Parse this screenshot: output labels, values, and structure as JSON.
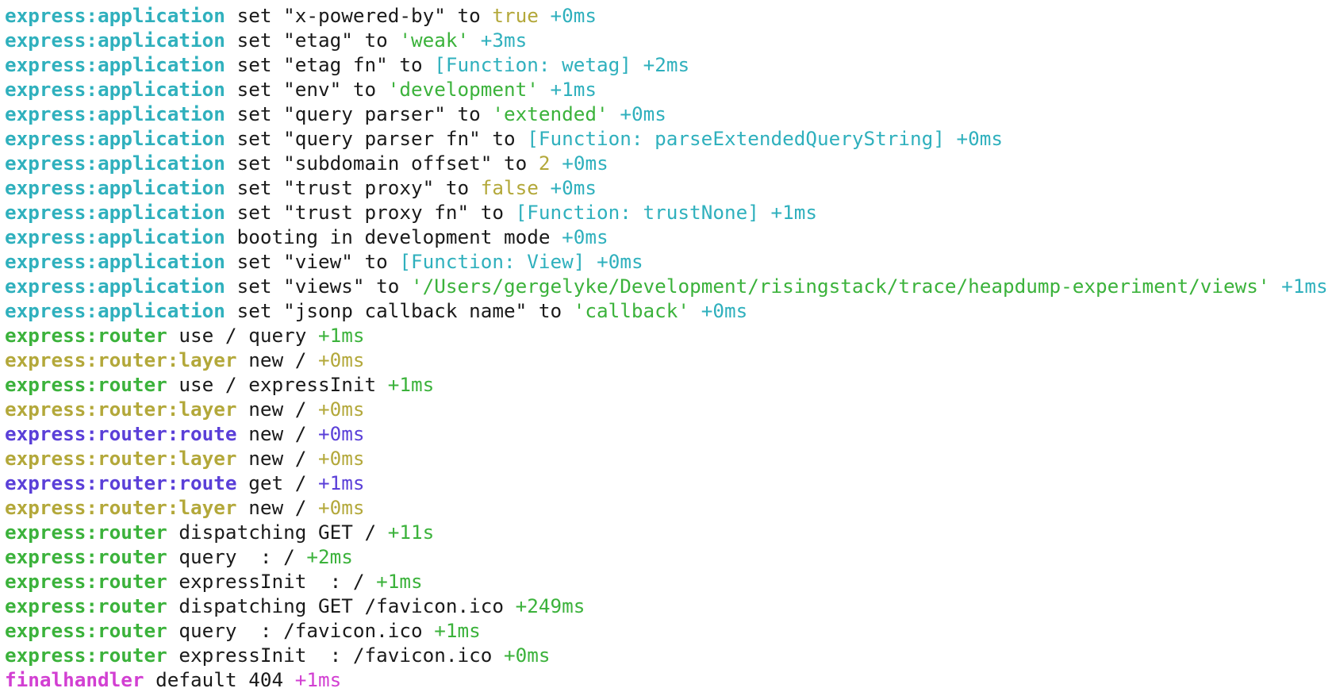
{
  "terminal": {
    "lines": [
      {
        "ns": "express:application",
        "ns_type": "application",
        "parts": [
          {
            "t": "msg",
            "v": " set \"x-powered-by\" to "
          },
          {
            "t": "bool",
            "v": "true"
          }
        ],
        "diff": "+0ms"
      },
      {
        "ns": "express:application",
        "ns_type": "application",
        "parts": [
          {
            "t": "msg",
            "v": " set \"etag\" to "
          },
          {
            "t": "str",
            "v": "'weak'"
          }
        ],
        "diff": "+3ms"
      },
      {
        "ns": "express:application",
        "ns_type": "application",
        "parts": [
          {
            "t": "msg",
            "v": " set \"etag fn\" to "
          },
          {
            "t": "fn",
            "v": "[Function: wetag]"
          }
        ],
        "diff": "+2ms"
      },
      {
        "ns": "express:application",
        "ns_type": "application",
        "parts": [
          {
            "t": "msg",
            "v": " set \"env\" to "
          },
          {
            "t": "str",
            "v": "'development'"
          }
        ],
        "diff": "+1ms"
      },
      {
        "ns": "express:application",
        "ns_type": "application",
        "parts": [
          {
            "t": "msg",
            "v": " set \"query parser\" to "
          },
          {
            "t": "str",
            "v": "'extended'"
          }
        ],
        "diff": "+0ms"
      },
      {
        "ns": "express:application",
        "ns_type": "application",
        "parts": [
          {
            "t": "msg",
            "v": " set \"query parser fn\" to "
          },
          {
            "t": "fn",
            "v": "[Function: parseExtendedQueryString]"
          }
        ],
        "diff": "+0ms"
      },
      {
        "ns": "express:application",
        "ns_type": "application",
        "parts": [
          {
            "t": "msg",
            "v": " set \"subdomain offset\" to "
          },
          {
            "t": "num",
            "v": "2"
          }
        ],
        "diff": "+0ms"
      },
      {
        "ns": "express:application",
        "ns_type": "application",
        "parts": [
          {
            "t": "msg",
            "v": " set \"trust proxy\" to "
          },
          {
            "t": "bool",
            "v": "false"
          }
        ],
        "diff": "+0ms"
      },
      {
        "ns": "express:application",
        "ns_type": "application",
        "parts": [
          {
            "t": "msg",
            "v": " set \"trust proxy fn\" to "
          },
          {
            "t": "fn",
            "v": "[Function: trustNone]"
          }
        ],
        "diff": "+1ms"
      },
      {
        "ns": "express:application",
        "ns_type": "application",
        "parts": [
          {
            "t": "msg",
            "v": " booting in development mode"
          }
        ],
        "diff": "+0ms"
      },
      {
        "ns": "express:application",
        "ns_type": "application",
        "parts": [
          {
            "t": "msg",
            "v": " set \"view\" to "
          },
          {
            "t": "fn",
            "v": "[Function: View]"
          }
        ],
        "diff": "+0ms"
      },
      {
        "ns": "express:application",
        "ns_type": "application",
        "parts": [
          {
            "t": "msg",
            "v": " set \"views\" to "
          },
          {
            "t": "str",
            "v": "'/Users/gergelyke/Development/risingstack/trace/heapdump-experiment/views'"
          }
        ],
        "diff": "+1ms"
      },
      {
        "ns": "express:application",
        "ns_type": "application",
        "parts": [
          {
            "t": "msg",
            "v": " set \"jsonp callback name\" to "
          },
          {
            "t": "str",
            "v": "'callback'"
          }
        ],
        "diff": "+0ms"
      },
      {
        "ns": "express:router",
        "ns_type": "router",
        "parts": [
          {
            "t": "msg",
            "v": " use / query"
          }
        ],
        "diff": "+1ms"
      },
      {
        "ns": "express:router:layer",
        "ns_type": "layer",
        "parts": [
          {
            "t": "msg",
            "v": " new /"
          }
        ],
        "diff": "+0ms"
      },
      {
        "ns": "express:router",
        "ns_type": "router",
        "parts": [
          {
            "t": "msg",
            "v": " use / expressInit"
          }
        ],
        "diff": "+1ms"
      },
      {
        "ns": "express:router:layer",
        "ns_type": "layer",
        "parts": [
          {
            "t": "msg",
            "v": " new /"
          }
        ],
        "diff": "+0ms"
      },
      {
        "ns": "express:router:route",
        "ns_type": "route",
        "parts": [
          {
            "t": "msg",
            "v": " new /"
          }
        ],
        "diff": "+0ms"
      },
      {
        "ns": "express:router:layer",
        "ns_type": "layer",
        "parts": [
          {
            "t": "msg",
            "v": " new /"
          }
        ],
        "diff": "+0ms"
      },
      {
        "ns": "express:router:route",
        "ns_type": "route",
        "parts": [
          {
            "t": "msg",
            "v": " get /"
          }
        ],
        "diff": "+1ms"
      },
      {
        "ns": "express:router:layer",
        "ns_type": "layer",
        "parts": [
          {
            "t": "msg",
            "v": " new /"
          }
        ],
        "diff": "+0ms"
      },
      {
        "ns": "express:router",
        "ns_type": "router",
        "parts": [
          {
            "t": "msg",
            "v": " dispatching GET /"
          }
        ],
        "diff": "+11s"
      },
      {
        "ns": "express:router",
        "ns_type": "router",
        "parts": [
          {
            "t": "msg",
            "v": " query  : /"
          }
        ],
        "diff": "+2ms"
      },
      {
        "ns": "express:router",
        "ns_type": "router",
        "parts": [
          {
            "t": "msg",
            "v": " expressInit  : /"
          }
        ],
        "diff": "+1ms"
      },
      {
        "ns": "express:router",
        "ns_type": "router",
        "parts": [
          {
            "t": "msg",
            "v": " dispatching GET /favicon.ico"
          }
        ],
        "diff": "+249ms"
      },
      {
        "ns": "express:router",
        "ns_type": "router",
        "parts": [
          {
            "t": "msg",
            "v": " query  : /favicon.ico"
          }
        ],
        "diff": "+1ms"
      },
      {
        "ns": "express:router",
        "ns_type": "router",
        "parts": [
          {
            "t": "msg",
            "v": " expressInit  : /favicon.ico"
          }
        ],
        "diff": "+0ms"
      },
      {
        "ns": "finalhandler",
        "ns_type": "finalhandler",
        "parts": [
          {
            "t": "msg",
            "v": " default 404"
          }
        ],
        "diff": "+1ms"
      }
    ]
  },
  "colors": {
    "background": "#ffffff",
    "text": "#1a1a1a",
    "application": "#2fb0bd",
    "router": "#3bb23b",
    "layer": "#b3a83a",
    "route": "#5a3fd8",
    "finalhandler": "#d23fd2"
  }
}
